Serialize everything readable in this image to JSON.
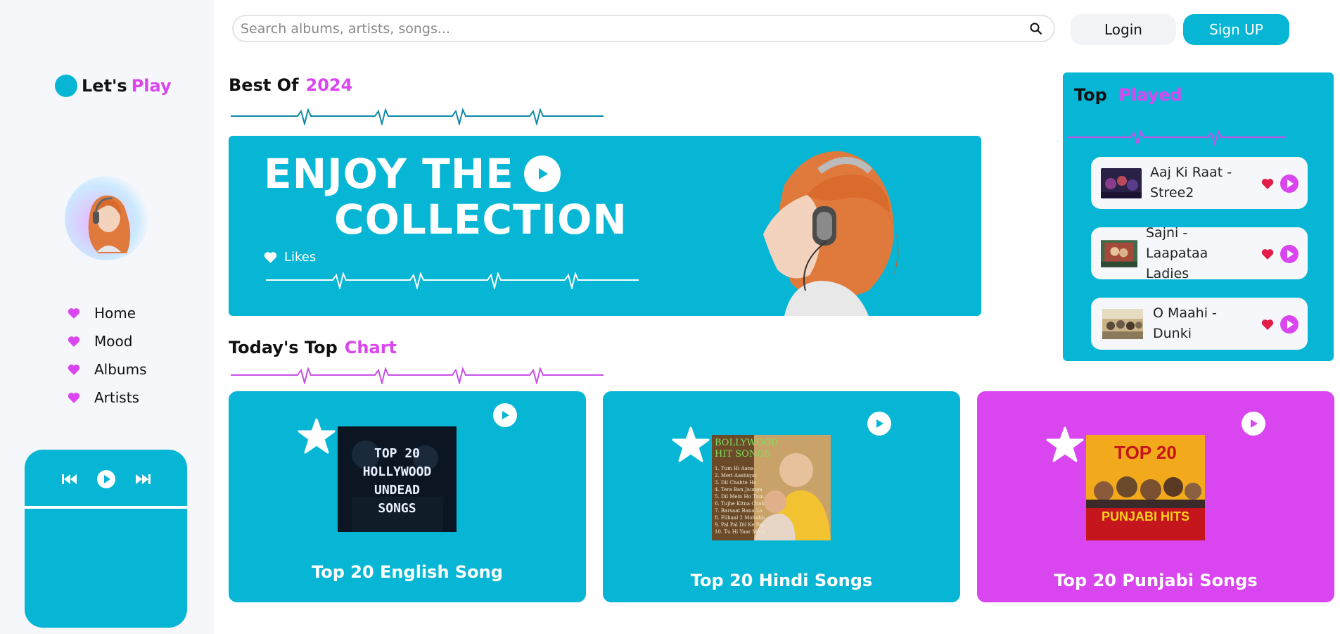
{
  "app": {
    "logo_part1": "Let's",
    "logo_part2": "Play"
  },
  "nav": {
    "items": [
      {
        "label": "Home"
      },
      {
        "label": "Mood"
      },
      {
        "label": "Albums"
      },
      {
        "label": "Artists"
      }
    ]
  },
  "header": {
    "search_placeholder": "Search albums, artists, songs...",
    "login_label": "Login",
    "signup_label": "Sign UP"
  },
  "best_of": {
    "title_part1": "Best Of",
    "title_part2": "2024",
    "banner_line1": "ENJOY THE",
    "banner_line2": "COLLECTION",
    "likes_label": "Likes"
  },
  "top_played": {
    "title_part1": "Top",
    "title_part2": "Played",
    "items": [
      {
        "title": "Aaj Ki Raat - Stree2"
      },
      {
        "title": "Sajni - Laapataa Ladies"
      },
      {
        "title": "O Maahi - Dunki"
      }
    ]
  },
  "top_chart": {
    "title_part1": "Today's Top",
    "title_part2": "Chart",
    "cards": [
      {
        "title": "Top 20 English Song",
        "cover_text": [
          "TOP 20",
          "HOLLYWOOD",
          "UNDEAD",
          "SONGS"
        ]
      },
      {
        "title": "Top 20 Hindi Songs",
        "cover_text": [
          "BOLLYWOOD",
          "HIT SONGS"
        ]
      },
      {
        "title": "Top 20 Punjabi Songs",
        "cover_text": [
          "TOP 20",
          "PUNJABI HITS"
        ]
      }
    ]
  },
  "colors": {
    "accent_cyan": "#06b6d4",
    "accent_pink": "#d946ef",
    "heart_red": "#e11d48"
  }
}
